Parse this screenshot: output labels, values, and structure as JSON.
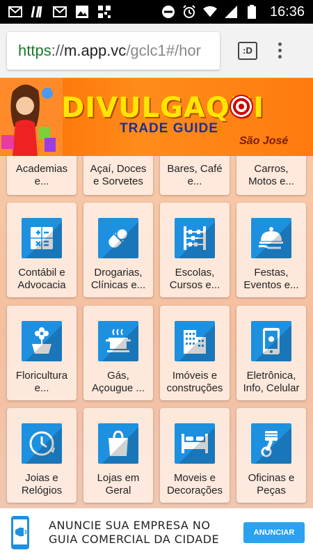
{
  "status_bar": {
    "time": "16:36",
    "left_icons": [
      "gmail-icon",
      "app-icon",
      "gmail-icon",
      "image-icon",
      "qr-icon"
    ],
    "right_icons": [
      "dnd-icon",
      "alarm-icon",
      "wifi-icon",
      "signal-icon",
      "battery-icon"
    ]
  },
  "browser": {
    "url_scheme": "https",
    "url_sep": "://",
    "url_host": "m.app.vc",
    "url_path": "/gclc1#/hor",
    "tabs_label": ":D"
  },
  "banner": {
    "title": "DIVULGAQUI",
    "subtitle": "TRADE GUIDE",
    "city": "São José"
  },
  "categories": [
    {
      "label": "Academias e...",
      "icon": "dumbbell-icon"
    },
    {
      "label": "Açaí, Doces e Sorvetes",
      "icon": "icecream-icon"
    },
    {
      "label": "Bares, Café e...",
      "icon": "cup-icon"
    },
    {
      "label": "Carros, Motos e...",
      "icon": "car-icon"
    },
    {
      "label": "Contábil e Advocacia",
      "icon": "calculator-icon"
    },
    {
      "label": "Drogarias, Clínicas e...",
      "icon": "pill-icon"
    },
    {
      "label": "Escolas, Cursos e...",
      "icon": "abacus-icon"
    },
    {
      "label": "Festas, Eventos e...",
      "icon": "cloche-icon"
    },
    {
      "label": "Floricultura e...",
      "icon": "flower-pot-icon"
    },
    {
      "label": "Gás, Açougue ...",
      "icon": "cooking-pot-icon"
    },
    {
      "label": "Imóveis e construções",
      "icon": "buildings-icon"
    },
    {
      "label": "Eletrônica, Info, Celular",
      "icon": "smartphone-icon"
    },
    {
      "label": "Joias e Relógios",
      "icon": "clock-icon"
    },
    {
      "label": "Lojas em Geral",
      "icon": "shopping-bag-icon"
    },
    {
      "label": "Moveis e Decorações",
      "icon": "bed-icon"
    },
    {
      "label": "Oficinas e Peças",
      "icon": "piston-icon"
    }
  ],
  "ad": {
    "line1": "ANUNCIE SUA EMPRESA NO",
    "line2": "GUIA COMERCIAL DA CIDADE",
    "button": "ANUNCIAR"
  },
  "colors": {
    "icon_blue": "#1e90e0",
    "banner_orange": "#ff7a10",
    "banner_yellow": "#ffe600",
    "ad_button": "#2aa2f0"
  }
}
